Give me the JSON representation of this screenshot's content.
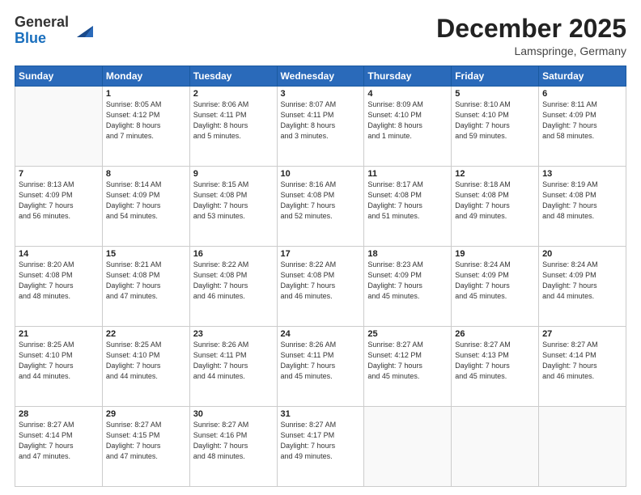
{
  "header": {
    "logo_general": "General",
    "logo_blue": "Blue",
    "month": "December 2025",
    "location": "Lamspringe, Germany"
  },
  "weekdays": [
    "Sunday",
    "Monday",
    "Tuesday",
    "Wednesday",
    "Thursday",
    "Friday",
    "Saturday"
  ],
  "weeks": [
    [
      {
        "day": "",
        "info": ""
      },
      {
        "day": "1",
        "info": "Sunrise: 8:05 AM\nSunset: 4:12 PM\nDaylight: 8 hours\nand 7 minutes."
      },
      {
        "day": "2",
        "info": "Sunrise: 8:06 AM\nSunset: 4:11 PM\nDaylight: 8 hours\nand 5 minutes."
      },
      {
        "day": "3",
        "info": "Sunrise: 8:07 AM\nSunset: 4:11 PM\nDaylight: 8 hours\nand 3 minutes."
      },
      {
        "day": "4",
        "info": "Sunrise: 8:09 AM\nSunset: 4:10 PM\nDaylight: 8 hours\nand 1 minute."
      },
      {
        "day": "5",
        "info": "Sunrise: 8:10 AM\nSunset: 4:10 PM\nDaylight: 7 hours\nand 59 minutes."
      },
      {
        "day": "6",
        "info": "Sunrise: 8:11 AM\nSunset: 4:09 PM\nDaylight: 7 hours\nand 58 minutes."
      }
    ],
    [
      {
        "day": "7",
        "info": "Sunrise: 8:13 AM\nSunset: 4:09 PM\nDaylight: 7 hours\nand 56 minutes."
      },
      {
        "day": "8",
        "info": "Sunrise: 8:14 AM\nSunset: 4:09 PM\nDaylight: 7 hours\nand 54 minutes."
      },
      {
        "day": "9",
        "info": "Sunrise: 8:15 AM\nSunset: 4:08 PM\nDaylight: 7 hours\nand 53 minutes."
      },
      {
        "day": "10",
        "info": "Sunrise: 8:16 AM\nSunset: 4:08 PM\nDaylight: 7 hours\nand 52 minutes."
      },
      {
        "day": "11",
        "info": "Sunrise: 8:17 AM\nSunset: 4:08 PM\nDaylight: 7 hours\nand 51 minutes."
      },
      {
        "day": "12",
        "info": "Sunrise: 8:18 AM\nSunset: 4:08 PM\nDaylight: 7 hours\nand 49 minutes."
      },
      {
        "day": "13",
        "info": "Sunrise: 8:19 AM\nSunset: 4:08 PM\nDaylight: 7 hours\nand 48 minutes."
      }
    ],
    [
      {
        "day": "14",
        "info": "Sunrise: 8:20 AM\nSunset: 4:08 PM\nDaylight: 7 hours\nand 48 minutes."
      },
      {
        "day": "15",
        "info": "Sunrise: 8:21 AM\nSunset: 4:08 PM\nDaylight: 7 hours\nand 47 minutes."
      },
      {
        "day": "16",
        "info": "Sunrise: 8:22 AM\nSunset: 4:08 PM\nDaylight: 7 hours\nand 46 minutes."
      },
      {
        "day": "17",
        "info": "Sunrise: 8:22 AM\nSunset: 4:08 PM\nDaylight: 7 hours\nand 46 minutes."
      },
      {
        "day": "18",
        "info": "Sunrise: 8:23 AM\nSunset: 4:09 PM\nDaylight: 7 hours\nand 45 minutes."
      },
      {
        "day": "19",
        "info": "Sunrise: 8:24 AM\nSunset: 4:09 PM\nDaylight: 7 hours\nand 45 minutes."
      },
      {
        "day": "20",
        "info": "Sunrise: 8:24 AM\nSunset: 4:09 PM\nDaylight: 7 hours\nand 44 minutes."
      }
    ],
    [
      {
        "day": "21",
        "info": "Sunrise: 8:25 AM\nSunset: 4:10 PM\nDaylight: 7 hours\nand 44 minutes."
      },
      {
        "day": "22",
        "info": "Sunrise: 8:25 AM\nSunset: 4:10 PM\nDaylight: 7 hours\nand 44 minutes."
      },
      {
        "day": "23",
        "info": "Sunrise: 8:26 AM\nSunset: 4:11 PM\nDaylight: 7 hours\nand 44 minutes."
      },
      {
        "day": "24",
        "info": "Sunrise: 8:26 AM\nSunset: 4:11 PM\nDaylight: 7 hours\nand 45 minutes."
      },
      {
        "day": "25",
        "info": "Sunrise: 8:27 AM\nSunset: 4:12 PM\nDaylight: 7 hours\nand 45 minutes."
      },
      {
        "day": "26",
        "info": "Sunrise: 8:27 AM\nSunset: 4:13 PM\nDaylight: 7 hours\nand 45 minutes."
      },
      {
        "day": "27",
        "info": "Sunrise: 8:27 AM\nSunset: 4:14 PM\nDaylight: 7 hours\nand 46 minutes."
      }
    ],
    [
      {
        "day": "28",
        "info": "Sunrise: 8:27 AM\nSunset: 4:14 PM\nDaylight: 7 hours\nand 47 minutes."
      },
      {
        "day": "29",
        "info": "Sunrise: 8:27 AM\nSunset: 4:15 PM\nDaylight: 7 hours\nand 47 minutes."
      },
      {
        "day": "30",
        "info": "Sunrise: 8:27 AM\nSunset: 4:16 PM\nDaylight: 7 hours\nand 48 minutes."
      },
      {
        "day": "31",
        "info": "Sunrise: 8:27 AM\nSunset: 4:17 PM\nDaylight: 7 hours\nand 49 minutes."
      },
      {
        "day": "",
        "info": ""
      },
      {
        "day": "",
        "info": ""
      },
      {
        "day": "",
        "info": ""
      }
    ]
  ]
}
